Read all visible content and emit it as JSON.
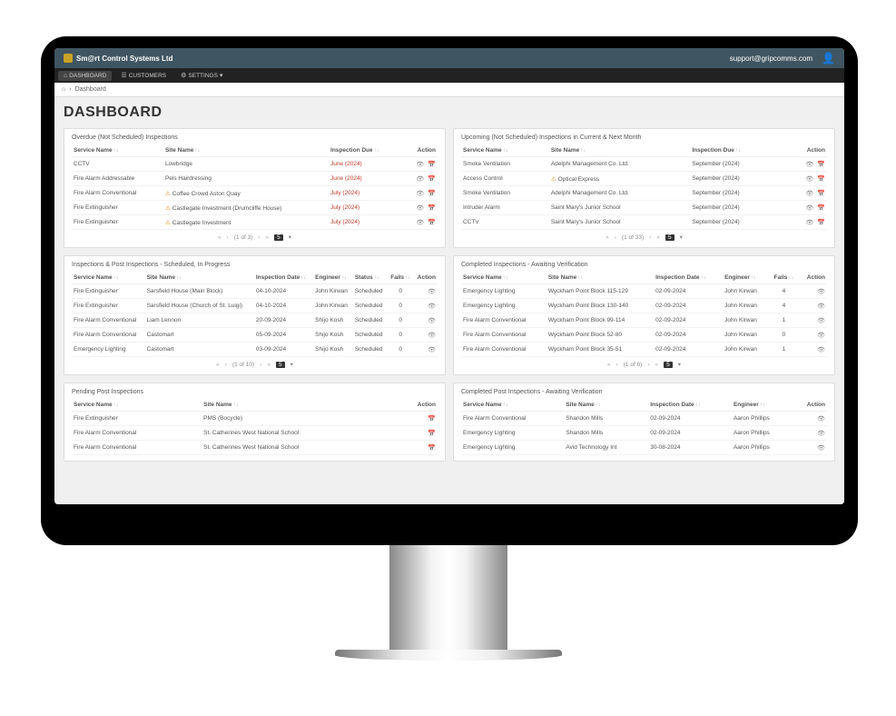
{
  "header": {
    "company": "Sm@rt Control Systems Ltd",
    "support_email": "support@gripcomms.com"
  },
  "nav": {
    "dashboard": "DASHBOARD",
    "customers": "CUSTOMERS",
    "settings": "SETTINGS"
  },
  "breadcrumb": {
    "home": "⌂",
    "sep": "›",
    "current": "Dashboard"
  },
  "title": "DASHBOARD",
  "labels": {
    "service_name": "Service Name",
    "site_name": "Site Name",
    "inspection_due": "Inspection Due",
    "inspection_date": "Inspection Date",
    "engineer": "Engineer",
    "status": "Status",
    "fails": "Fails",
    "action": "Action",
    "first": "«",
    "prev": "‹",
    "next": "›",
    "last": "»",
    "size": "5"
  },
  "panels": {
    "overdue": {
      "title": "Overdue (Not Scheduled) Inspections",
      "pager": "(1 of 3)",
      "rows": [
        {
          "service": "CCTV",
          "warn": false,
          "site": "Lowbridge",
          "due": "June (2024)"
        },
        {
          "service": "Fire Alarm Addressable",
          "warn": false,
          "site": "Pels Hairdressing",
          "due": "June (2024)"
        },
        {
          "service": "Fire Alarm Conventional",
          "warn": true,
          "site": "Coffee Crowd Aston Quay",
          "due": "July (2024)"
        },
        {
          "service": "Fire Extinguisher",
          "warn": true,
          "site": "Castlegate Investment (Drumcliffe House)",
          "due": "July (2024)"
        },
        {
          "service": "Fire Extinguisher",
          "warn": true,
          "site": "Castlegate Investment",
          "due": "July (2024)"
        }
      ]
    },
    "upcoming": {
      "title": "Upcoming (Not Scheduled) Inspections in Current & Next Month",
      "pager": "(1 of 33)",
      "rows": [
        {
          "service": "Smoke Ventilation",
          "warn": false,
          "site": "Adelphi Management Co. Ltd.",
          "due": "September (2024)"
        },
        {
          "service": "Access Control",
          "warn": true,
          "site": "Optical Express",
          "due": "September (2024)"
        },
        {
          "service": "Smoke Ventilation",
          "warn": false,
          "site": "Adelphi Management Co. Ltd.",
          "due": "September (2024)"
        },
        {
          "service": "Intruder Alarm",
          "warn": false,
          "site": "Saint Mary's Junior School",
          "due": "September (2024)"
        },
        {
          "service": "CCTV",
          "warn": false,
          "site": "Saint Mary's Junior School",
          "due": "September (2024)"
        }
      ]
    },
    "scheduled": {
      "title": "Inspections & Post Inspections - Scheduled, In Progress",
      "pager": "(1 of 10)",
      "rows": [
        {
          "service": "Fire Extinguisher",
          "site": "Sarsfield House (Main Block)",
          "date": "04-10-2024",
          "engineer": "John Kirwan",
          "status": "Scheduled",
          "fails": "0"
        },
        {
          "service": "Fire Extinguisher",
          "site": "Sarsfield House (Church of St. Luigi)",
          "date": "04-10-2024",
          "engineer": "John Kirwan",
          "status": "Scheduled",
          "fails": "0"
        },
        {
          "service": "Fire Alarm Conventional",
          "site": "Liam Lennon",
          "date": "20-09-2024",
          "engineer": "Shijo Kosh",
          "status": "Scheduled",
          "fails": "0"
        },
        {
          "service": "Fire Alarm Conventional",
          "site": "Castomart",
          "date": "05-09-2024",
          "engineer": "Shijo Kosh",
          "status": "Scheduled",
          "fails": "0"
        },
        {
          "service": "Emergency Lighting",
          "site": "Castomart",
          "date": "03-09-2024",
          "engineer": "Shijo Kosh",
          "status": "Scheduled",
          "fails": "0"
        }
      ]
    },
    "completed_insp": {
      "title": "Completed Inspections - Awaiting Verification",
      "pager": "(1 of 6)",
      "rows": [
        {
          "service": "Emergency Lighting",
          "site": "Wyckham Point Block 115-129",
          "date": "02-09-2024",
          "engineer": "John Kirwan",
          "fails": "4"
        },
        {
          "service": "Emergency Lighting",
          "site": "Wyckham Point Block 130-140",
          "date": "02-09-2024",
          "engineer": "John Kirwan",
          "fails": "4"
        },
        {
          "service": "Fire Alarm Conventional",
          "site": "Wyckham Point Block 99-114",
          "date": "02-09-2024",
          "engineer": "John Kirwan",
          "fails": "1"
        },
        {
          "service": "Fire Alarm Conventional",
          "site": "Wyckham Point Block 52-80",
          "date": "02-09-2024",
          "engineer": "John Kirwan",
          "fails": "0"
        },
        {
          "service": "Fire Alarm Conventional",
          "site": "Wyckham Point Block 35-51",
          "date": "02-09-2024",
          "engineer": "John Kirwan",
          "fails": "1"
        }
      ]
    },
    "pending_post": {
      "title": "Pending Post Inspections",
      "rows": [
        {
          "service": "Fire Extinguisher",
          "site": "PMS (Bocycle)"
        },
        {
          "service": "Fire Alarm Conventional",
          "site": "St. Catherines West National School"
        },
        {
          "service": "Fire Alarm Conventional",
          "site": "St. Catherines West National School"
        }
      ]
    },
    "completed_post": {
      "title": "Completed Post Inspections - Awaiting Verification",
      "rows": [
        {
          "service": "Fire Alarm Conventional",
          "site": "Shandon Mills",
          "date": "02-09-2024",
          "engineer": "Aaron Phillips"
        },
        {
          "service": "Emergency Lighting",
          "site": "Shandon Mills",
          "date": "02-09-2024",
          "engineer": "Aaron Phillips"
        },
        {
          "service": "Emergency Lighting",
          "site": "Avid Technology Int",
          "date": "30-08-2024",
          "engineer": "Aaron Phillips"
        }
      ]
    }
  }
}
